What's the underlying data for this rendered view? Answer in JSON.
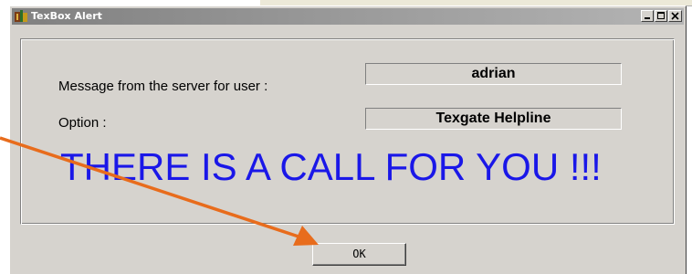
{
  "window": {
    "title": "TexBox Alert"
  },
  "form": {
    "message_label": "Message from the server for user :",
    "user_value": "adrian",
    "option_label": "Option :",
    "option_value": "Texgate Helpline"
  },
  "alert": {
    "text": "THERE IS A CALL FOR YOU !!!",
    "color": "#1a17e8"
  },
  "buttons": {
    "ok_label": "OK"
  },
  "annotation": {
    "arrow_color": "#e86c1c"
  },
  "icons": [
    "app-icon",
    "minimize-icon",
    "maximize-icon",
    "close-icon",
    "arrow-annotation"
  ]
}
